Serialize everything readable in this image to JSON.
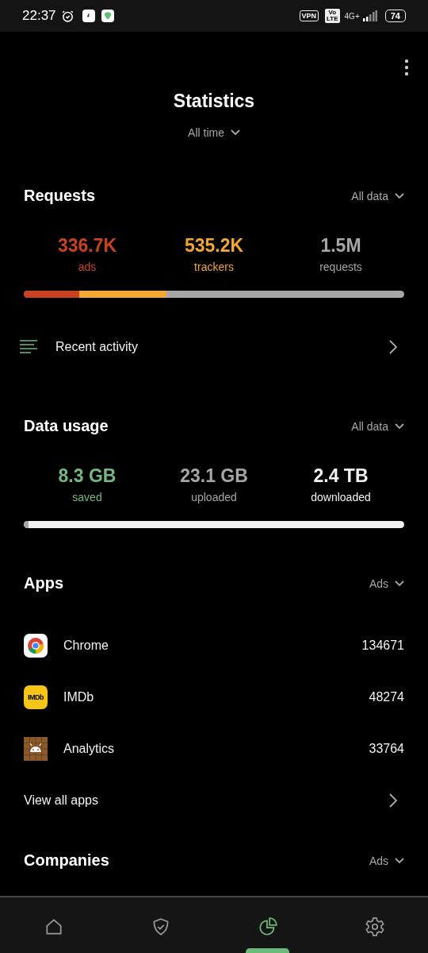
{
  "status_bar": {
    "time": "22:37",
    "vpn": "VPN",
    "volte_top": "Vo",
    "volte_bottom": "LTE",
    "network": "4G+",
    "battery": "74"
  },
  "header": {
    "title": "Statistics",
    "period": "All time"
  },
  "requests": {
    "title": "Requests",
    "filter": "All data",
    "stats": [
      {
        "value": "336.7K",
        "label": "ads",
        "color": "#c9421f"
      },
      {
        "value": "535.2K",
        "label": "trackers",
        "color": "#f2a634"
      },
      {
        "value": "1.5M",
        "label": "requests",
        "color": "#a6a6a6"
      }
    ],
    "bar": {
      "color": "#a6a6a6",
      "segments": [
        {
          "level": 0.145,
          "color": "#c9421f"
        },
        {
          "level": 0.23,
          "color": "#f2a634"
        }
      ]
    },
    "link": "Recent activity"
  },
  "data_usage": {
    "title": "Data usage",
    "filter": "All data",
    "stats": [
      {
        "value": "8.3 GB",
        "label": "saved",
        "color": "#74b882"
      },
      {
        "value": "23.1 GB",
        "label": "uploaded",
        "color": "#a6a6a6"
      },
      {
        "value": "2.4 TB",
        "label": "downloaded",
        "color": "#f2f2f2"
      }
    ],
    "bar": {
      "color": "#f2f2f2",
      "segments": [
        {
          "level": 0.012,
          "color": "#a6a6a6"
        }
      ]
    }
  },
  "apps": {
    "title": "Apps",
    "filter": "Ads",
    "items": [
      {
        "name": "Chrome",
        "count": "134671",
        "kind": "chrome"
      },
      {
        "name": "IMDb",
        "count": "48274",
        "kind": "imdb",
        "icon_text": "IMDb"
      },
      {
        "name": "Analytics",
        "count": "33764",
        "kind": "android"
      }
    ],
    "link": "View all apps"
  },
  "companies": {
    "title": "Companies",
    "filter": "Ads"
  },
  "bottom_nav": [
    {
      "kind": "home",
      "selected": false
    },
    {
      "kind": "shield",
      "selected": false
    },
    {
      "kind": "stats",
      "selected": true
    },
    {
      "kind": "settings",
      "selected": false
    }
  ]
}
